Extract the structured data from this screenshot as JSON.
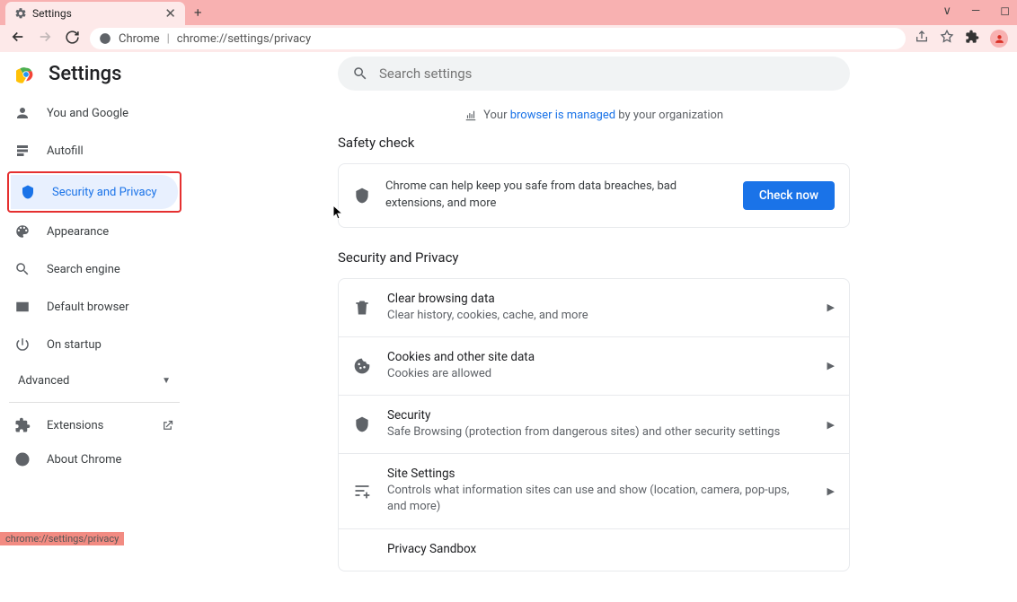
{
  "tab": {
    "title": "Settings"
  },
  "addressBar": {
    "label": "Chrome",
    "url": "chrome://settings/privacy"
  },
  "header": {
    "title": "Settings"
  },
  "search": {
    "placeholder": "Search settings"
  },
  "managed": {
    "prefix": "Your ",
    "link": "browser is managed",
    "suffix": " by your organization"
  },
  "nav": {
    "you": "You and Google",
    "autofill": "Autofill",
    "security": "Security and Privacy",
    "appearance": "Appearance",
    "searchEngine": "Search engine",
    "defaultBrowser": "Default browser",
    "startup": "On startup",
    "advanced": "Advanced",
    "extensions": "Extensions",
    "about": "About Chrome"
  },
  "safety": {
    "title": "Safety check",
    "desc": "Chrome can help keep you safe from data breaches, bad extensions, and more",
    "button": "Check now"
  },
  "privacy": {
    "title": "Security and Privacy",
    "rows": [
      {
        "title": "Clear browsing data",
        "sub": "Clear history, cookies, cache, and more"
      },
      {
        "title": "Cookies and other site data",
        "sub": "Cookies are allowed"
      },
      {
        "title": "Security",
        "sub": "Safe Browsing (protection from dangerous sites) and other security settings"
      },
      {
        "title": "Site Settings",
        "sub": "Controls what information sites can use and show (location, camera, pop-ups, and more)"
      },
      {
        "title": "Privacy Sandbox",
        "sub": ""
      }
    ]
  },
  "statusBar": "chrome://settings/privacy"
}
